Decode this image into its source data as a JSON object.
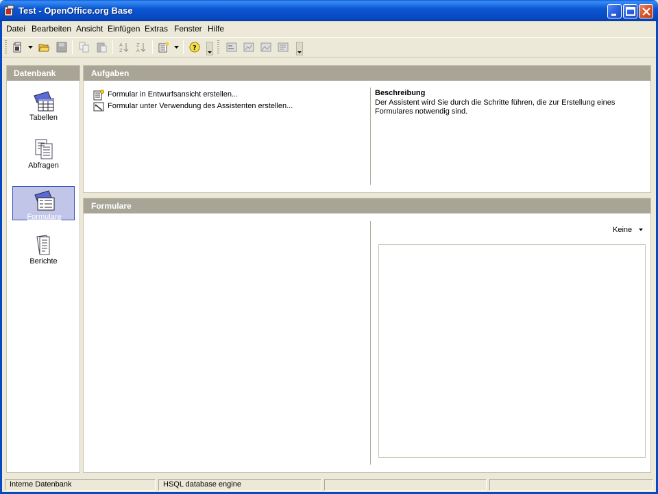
{
  "window": {
    "title": "Test - OpenOffice.org Base"
  },
  "menu": [
    {
      "label": "Datei"
    },
    {
      "label": "Bearbeiten"
    },
    {
      "label": "Ansicht"
    },
    {
      "label": "Einfügen"
    },
    {
      "label": "Extras"
    },
    {
      "label": "Fenster"
    },
    {
      "label": "Hilfe"
    }
  ],
  "toolbar": {
    "icons": [
      "new-document-icon",
      "open-folder-icon",
      "save-icon",
      "copy-icon",
      "paste-icon",
      "sort-ascending-icon",
      "sort-descending-icon",
      "new-form-icon",
      "help-icon",
      "form-design-icon",
      "report-icon",
      "image-icon",
      "list-icon"
    ]
  },
  "sidebar": {
    "header": "Datenbank",
    "items": [
      {
        "label": "Tabellen",
        "selected": false
      },
      {
        "label": "Abfragen",
        "selected": false
      },
      {
        "label": "Formulare",
        "selected": true
      },
      {
        "label": "Berichte",
        "selected": false
      }
    ]
  },
  "tasks": {
    "header": "Aufgaben",
    "items": [
      {
        "label": "Formular in Entwurfsansicht erstellen..."
      },
      {
        "label": "Formular unter Verwendung des Assistenten erstellen..."
      }
    ],
    "description_title": "Beschreibung",
    "description_text": "Der Assistent wird Sie durch die Schritte führen, die zur Erstellung eines Formulares notwendig sind."
  },
  "forms": {
    "header": "Formulare",
    "preview_mode": "Keine"
  },
  "statusbar": {
    "cells": [
      "Interne Datenbank",
      "HSQL database engine",
      "",
      ""
    ]
  },
  "colors": {
    "titlebar": "#0848c0",
    "panel_header": "#a8a597",
    "selection": "#4a5cc0",
    "background": "#ece9d8"
  }
}
